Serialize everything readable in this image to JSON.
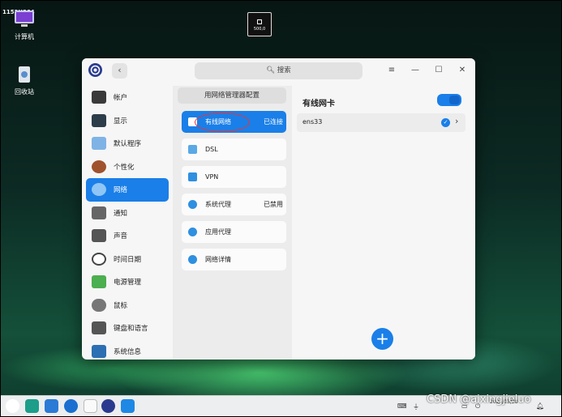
{
  "desktop": {
    "resolution_label": "1152X864",
    "icons": [
      {
        "label": "计算机"
      },
      {
        "label": "回收站"
      }
    ],
    "capture_box_label": "500,0"
  },
  "window": {
    "search_placeholder": "搜索",
    "controls": {
      "menu": "≡",
      "minimize": "—",
      "maximize": "☐",
      "close": "✕"
    },
    "back_symbol": "‹"
  },
  "sidebar": {
    "items": [
      {
        "label": "帐户",
        "icon": "account-icon",
        "color": "#3a3a3a"
      },
      {
        "label": "显示",
        "icon": "display-icon",
        "color": "#2d3d4a"
      },
      {
        "label": "默认程序",
        "icon": "default-apps-icon",
        "color": "#7fb3e6"
      },
      {
        "label": "个性化",
        "icon": "personalization-icon",
        "color": "#a0522d"
      },
      {
        "label": "网络",
        "icon": "network-icon",
        "color": "#8fc6f5"
      },
      {
        "label": "通知",
        "icon": "notification-icon",
        "color": "#666666"
      },
      {
        "label": "声音",
        "icon": "sound-icon",
        "color": "#555555"
      },
      {
        "label": "时间日期",
        "icon": "clock-icon",
        "color": "#444444"
      },
      {
        "label": "电源管理",
        "icon": "battery-icon",
        "color": "#4caf50"
      },
      {
        "label": "鼠标",
        "icon": "mouse-icon",
        "color": "#777777"
      },
      {
        "label": "键盘和语言",
        "icon": "keyboard-icon",
        "color": "#555555"
      },
      {
        "label": "系统信息",
        "icon": "system-info-icon",
        "color": "#2c6fb3"
      }
    ],
    "active_index": 4
  },
  "middle": {
    "header": "用网络管理器配置",
    "items": [
      {
        "label": "有线网络",
        "status": "已连接",
        "icon": "wired-icon"
      },
      {
        "label": "DSL",
        "status": "",
        "icon": "dsl-icon"
      },
      {
        "label": "VPN",
        "status": "",
        "icon": "vpn-icon"
      },
      {
        "label": "系统代理",
        "status": "已禁用",
        "icon": "proxy-icon"
      },
      {
        "label": "应用代理",
        "status": "",
        "icon": "app-proxy-icon"
      },
      {
        "label": "网络详情",
        "status": "",
        "icon": "info-icon"
      }
    ],
    "active_index": 0
  },
  "right": {
    "title": "有线网卡",
    "toggle_on": true,
    "device": {
      "name": "ens33",
      "connected": true
    },
    "add_symbol": "+"
  },
  "taskbar": {
    "date": "2024/03/28",
    "watermark": "CSDN @aixingjieluo"
  },
  "colors": {
    "accent": "#1a7fe8",
    "window_bg": "#f6f6f6"
  }
}
